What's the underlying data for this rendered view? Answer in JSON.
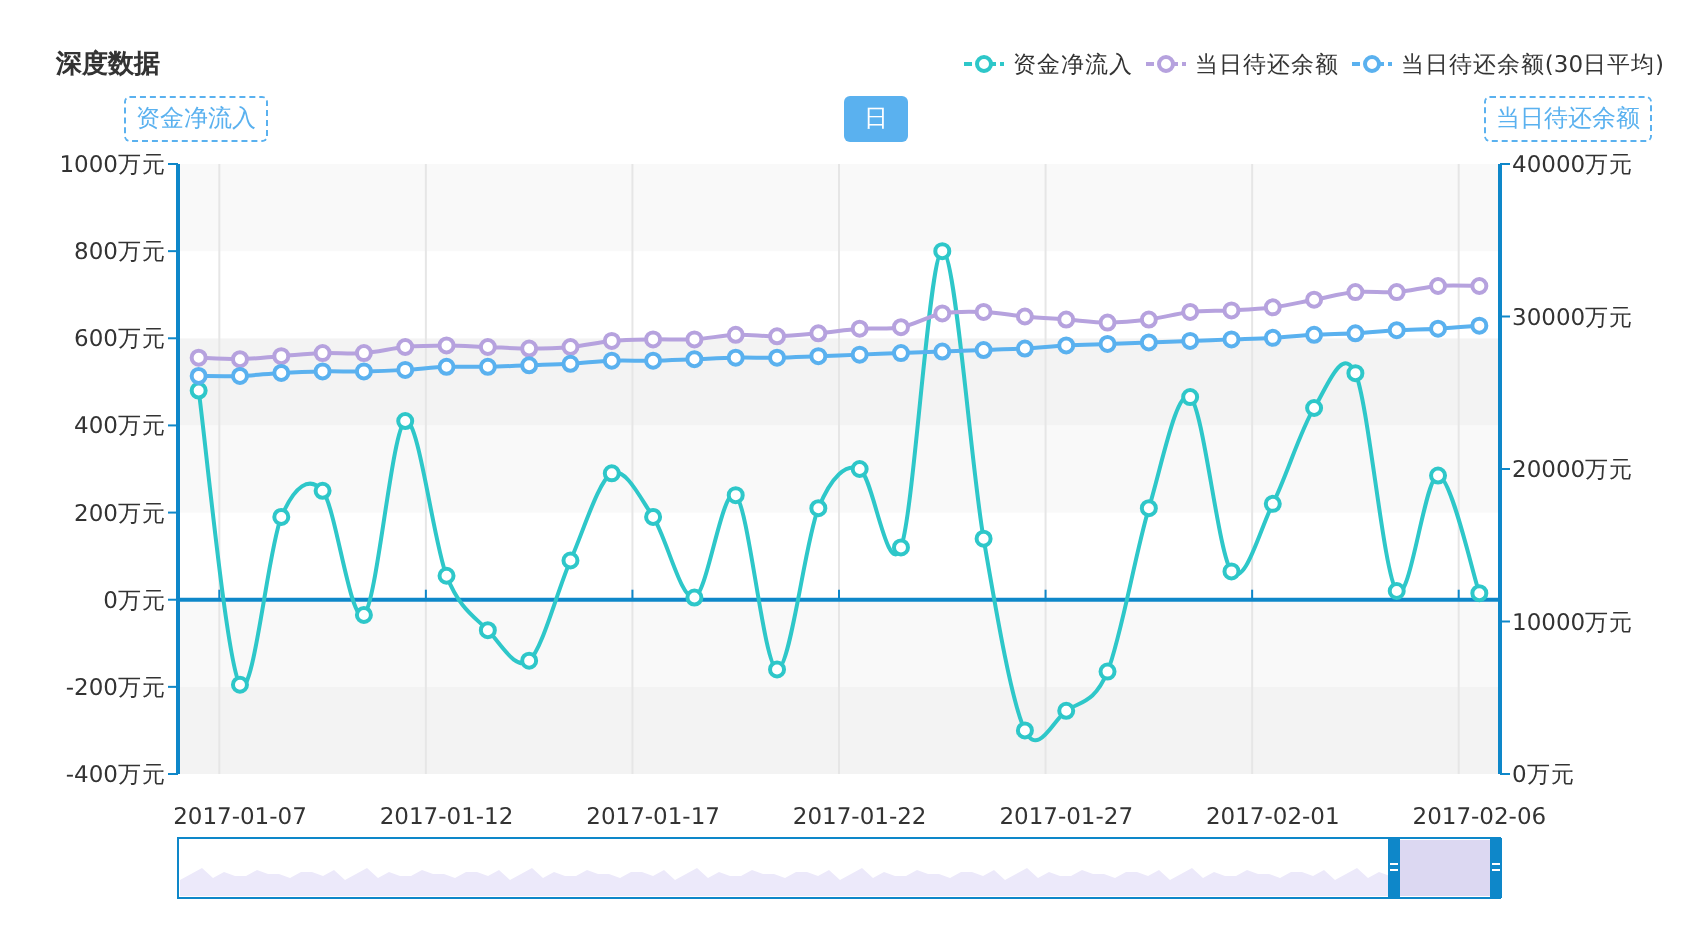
{
  "title": "深度数据",
  "axis_names": {
    "left": "资金净流入",
    "right": "当日待还余额"
  },
  "period_button": {
    "label": "日",
    "selected": true
  },
  "chart_data": {
    "type": "line",
    "categories": [
      null,
      "2017-01-07",
      null,
      null,
      null,
      null,
      "2017-01-12",
      null,
      null,
      null,
      null,
      "2017-01-17",
      null,
      null,
      null,
      null,
      "2017-01-22",
      null,
      null,
      null,
      null,
      "2017-01-27",
      null,
      null,
      null,
      null,
      "2017-02-01",
      null,
      null,
      null,
      null,
      "2017-02-06"
    ],
    "grid": true,
    "ref_lines": [
      {
        "axis": "y",
        "value": 0,
        "color": "#0e87c9"
      }
    ],
    "ylim": [
      -400,
      1000
    ],
    "yticks": [
      {
        "value": -400,
        "label": "-400万元"
      },
      {
        "value": -200,
        "label": "-200万元"
      },
      {
        "value": 0,
        "label": "0万元"
      },
      {
        "value": 200,
        "label": "200万元"
      },
      {
        "value": 400,
        "label": "400万元"
      },
      {
        "value": 600,
        "label": "600万元"
      },
      {
        "value": 800,
        "label": "800万元"
      },
      {
        "value": 1000,
        "label": "1000万元"
      }
    ],
    "y2lim": [
      0,
      40000
    ],
    "y2ticks": [
      {
        "value": 0,
        "label": "0万元"
      },
      {
        "value": 10000,
        "label": "10000万元"
      },
      {
        "value": 20000,
        "label": "20000万元"
      },
      {
        "value": 30000,
        "label": "30000万元"
      },
      {
        "value": 40000,
        "label": "40000万元"
      }
    ],
    "series": [
      {
        "name": "资金净流入",
        "color": "#2ec7c9",
        "marker": "circle",
        "values": [
          480,
          -195,
          190,
          250,
          -35,
          410,
          55,
          -70,
          -140,
          90,
          290,
          190,
          5,
          240,
          -160,
          210,
          300,
          120,
          800,
          140,
          -300,
          -255,
          -165,
          210,
          465,
          65,
          220,
          440,
          520,
          20,
          285,
          15
        ]
      },
      {
        "name": "当日待还余额",
        "color": "#b6a2de",
        "axis": "y2",
        "marker": "circle",
        "values": [
          27300,
          27200,
          27400,
          27600,
          27600,
          28000,
          28100,
          28000,
          27900,
          28000,
          28400,
          28500,
          28500,
          28800,
          28700,
          28900,
          29200,
          29300,
          30200,
          30300,
          30000,
          29800,
          29600,
          29800,
          30300,
          30400,
          30600,
          31100,
          31600,
          31600,
          32000,
          32000
        ]
      },
      {
        "name": "当日待还余额(30日平均)",
        "color": "#5ab1ef",
        "axis": "y2",
        "marker": "circle",
        "values": [
          26100,
          26100,
          26300,
          26400,
          26400,
          26500,
          26700,
          26700,
          26800,
          26900,
          27100,
          27100,
          27200,
          27300,
          27300,
          27400,
          27500,
          27600,
          27700,
          27800,
          27900,
          28100,
          28200,
          28300,
          28400,
          28500,
          28600,
          28800,
          28900,
          29100,
          29200,
          29400
        ]
      }
    ]
  }
}
